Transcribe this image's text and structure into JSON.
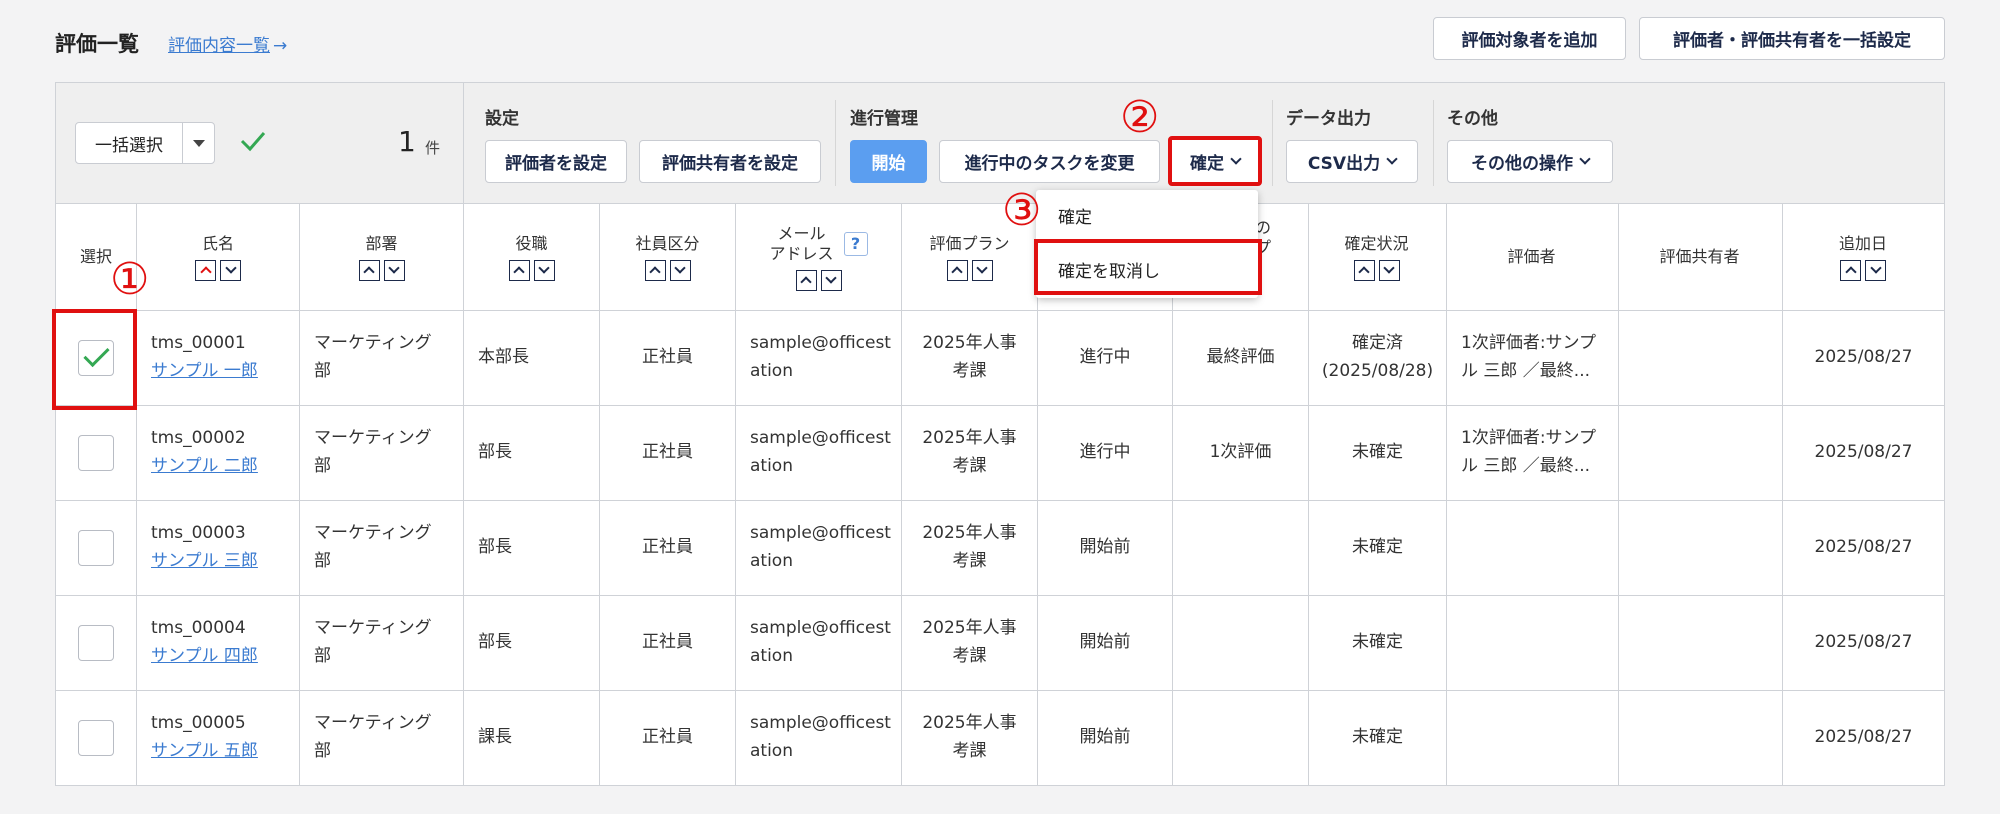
{
  "header": {
    "title": "評価一覧",
    "link_label": "評価内容一覧",
    "link_arrow": "→",
    "add_target_label": "評価対象者を追加",
    "bulk_set_label": "評価者・評価共有者を一括設定"
  },
  "toolbar": {
    "bulk_select_label": "一括選択",
    "count": "1",
    "count_unit": "件",
    "sections": {
      "settings": "設定",
      "progress": "進行管理",
      "data_export": "データ出力",
      "other": "その他"
    },
    "buttons": {
      "set_evaluator": "評価者を設定",
      "set_sharer": "評価共有者を設定",
      "start": "開始",
      "change_task": "進行中のタスクを変更",
      "confirm": "確定",
      "csv_export": "CSV出力",
      "other_ops": "その他の操作"
    }
  },
  "confirm_menu": {
    "items": [
      "確定",
      "確定を取消し"
    ]
  },
  "table": {
    "headers": {
      "select": "選択",
      "name": "氏名",
      "dept": "部署",
      "position": "役職",
      "emp_type": "社員区分",
      "email_1": "メール",
      "email_2": "アドレス",
      "email_help": "?",
      "plan": "評価プラン",
      "status_hidden_1": "の",
      "status_hidden_2": "プ",
      "confirm_status": "確定状況",
      "evaluator": "評価者",
      "sharer": "評価共有者",
      "added_date": "追加日"
    },
    "rows": [
      {
        "checked": true,
        "code": "tms_00001",
        "name": "サンプル 一郎",
        "dept_1": "マーケティング",
        "dept_2": "部",
        "position": "本部長",
        "emp_type": "正社員",
        "email_1": "sample@officest",
        "email_2": "ation",
        "plan_1": "2025年人事",
        "plan_2": "考課",
        "progress": "進行中",
        "step": "最終評価",
        "confirm_1": "確定済",
        "confirm_2": "(2025/08/28)",
        "evaluator_1": "1次評価者:サンプ",
        "evaluator_2": "ル 三郎 ／最終...",
        "date": "2025/08/27"
      },
      {
        "checked": false,
        "code": "tms_00002",
        "name": "サンプル 二郎",
        "dept_1": "マーケティング",
        "dept_2": "部",
        "position": "部長",
        "emp_type": "正社員",
        "email_1": "sample@officest",
        "email_2": "ation",
        "plan_1": "2025年人事",
        "plan_2": "考課",
        "progress": "進行中",
        "step": "1次評価",
        "confirm_1": "未確定",
        "confirm_2": "",
        "evaluator_1": "1次評価者:サンプ",
        "evaluator_2": "ル 三郎 ／最終...",
        "date": "2025/08/27"
      },
      {
        "checked": false,
        "code": "tms_00003",
        "name": "サンプル 三郎",
        "dept_1": "マーケティング",
        "dept_2": "部",
        "position": "部長",
        "emp_type": "正社員",
        "email_1": "sample@officest",
        "email_2": "ation",
        "plan_1": "2025年人事",
        "plan_2": "考課",
        "progress": "開始前",
        "step": "",
        "confirm_1": "未確定",
        "confirm_2": "",
        "evaluator_1": "",
        "evaluator_2": "",
        "date": "2025/08/27"
      },
      {
        "checked": false,
        "code": "tms_00004",
        "name": "サンプル 四郎",
        "dept_1": "マーケティング",
        "dept_2": "部",
        "position": "部長",
        "emp_type": "正社員",
        "email_1": "sample@officest",
        "email_2": "ation",
        "plan_1": "2025年人事",
        "plan_2": "考課",
        "progress": "開始前",
        "step": "",
        "confirm_1": "未確定",
        "confirm_2": "",
        "evaluator_1": "",
        "evaluator_2": "",
        "date": "2025/08/27"
      },
      {
        "checked": false,
        "code": "tms_00005",
        "name": "サンプル 五郎",
        "dept_1": "マーケティング",
        "dept_2": "部",
        "position": "課長",
        "emp_type": "正社員",
        "email_1": "sample@officest",
        "email_2": "ation",
        "plan_1": "2025年人事",
        "plan_2": "考課",
        "progress": "開始前",
        "step": "",
        "confirm_1": "未確定",
        "confirm_2": "",
        "evaluator_1": "",
        "evaluator_2": "",
        "date": "2025/08/27"
      }
    ]
  },
  "annotations": [
    "①",
    "②",
    "③"
  ],
  "colors": {
    "accent_blue": "#5b9ef0",
    "link_blue": "#3b7bd0",
    "highlight_red": "#e01010",
    "check_green": "#34a853"
  },
  "icons": [
    "check-icon",
    "sort-up-icon",
    "sort-down-icon",
    "help-icon",
    "chevron-down-icon",
    "arrow-right-icon"
  ]
}
